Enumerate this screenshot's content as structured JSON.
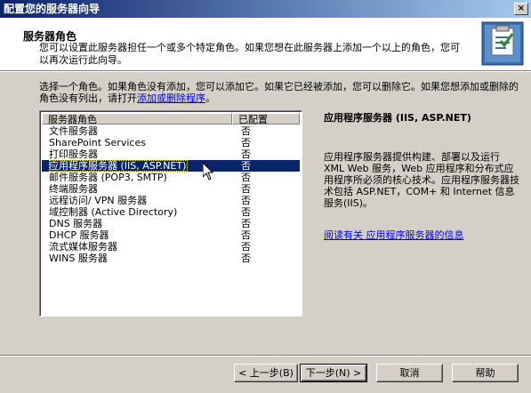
{
  "window": {
    "title": "配置您的服务器向导",
    "close_glyph": "×"
  },
  "header": {
    "title": "服务器角色",
    "subtitle": "您可以设置此服务器担任一个或多个特定角色。如果您想在此服务器上添加一个以上的角色，您可以再次运行此向导。"
  },
  "instructions": {
    "text": "选择一个角色。如果角色没有添加，您可以添加它。如果它已经被添加，您可以删除它。如果您想添加或删除的角色没有列出，请打开",
    "link": "添加或删除程序",
    "suffix": "。"
  },
  "roles_list": {
    "columns": {
      "name": "服务器角色",
      "status": "已配置"
    },
    "rows": [
      {
        "name": "文件服务器",
        "status": "否",
        "selected": false
      },
      {
        "name": "SharePoint Services",
        "status": "否",
        "selected": false
      },
      {
        "name": "打印服务器",
        "status": "否",
        "selected": false
      },
      {
        "name": "应用程序服务器 (IIS, ASP.NET)",
        "status": "否",
        "selected": true
      },
      {
        "name": "邮件服务器 (POP3, SMTP)",
        "status": "否",
        "selected": false
      },
      {
        "name": "终端服务器",
        "status": "否",
        "selected": false
      },
      {
        "name": "远程访问/ VPN 服务器",
        "status": "否",
        "selected": false
      },
      {
        "name": "域控制器 (Active Directory)",
        "status": "否",
        "selected": false
      },
      {
        "name": "DNS 服务器",
        "status": "否",
        "selected": false
      },
      {
        "name": "DHCP 服务器",
        "status": "否",
        "selected": false
      },
      {
        "name": "流式媒体服务器",
        "status": "否",
        "selected": false
      },
      {
        "name": "WINS 服务器",
        "status": "否",
        "selected": false
      }
    ]
  },
  "description": {
    "title": "应用程序服务器 (IIS, ASP.NET)",
    "body": "应用程序服务器提供构建、部署以及运行 XML Web 服务，Web 应用程序和分布式应用程序所必须的核心技术。应用程序服务器技术包括 ASP.NET，COM+ 和 Internet 信息服务(IIS)。",
    "link": "阅读有关 应用程序服务器的信息"
  },
  "buttons": {
    "back": "< 上一步(B)",
    "next": "下一步(N) >",
    "cancel": "取消",
    "help": "帮助"
  },
  "colors": {
    "selection": "#0a246a",
    "link": "#0000ee",
    "face": "#d4d0c8"
  },
  "icons": {
    "wizard": "server-checklist-icon",
    "cursor": "mouse-pointer-icon"
  }
}
